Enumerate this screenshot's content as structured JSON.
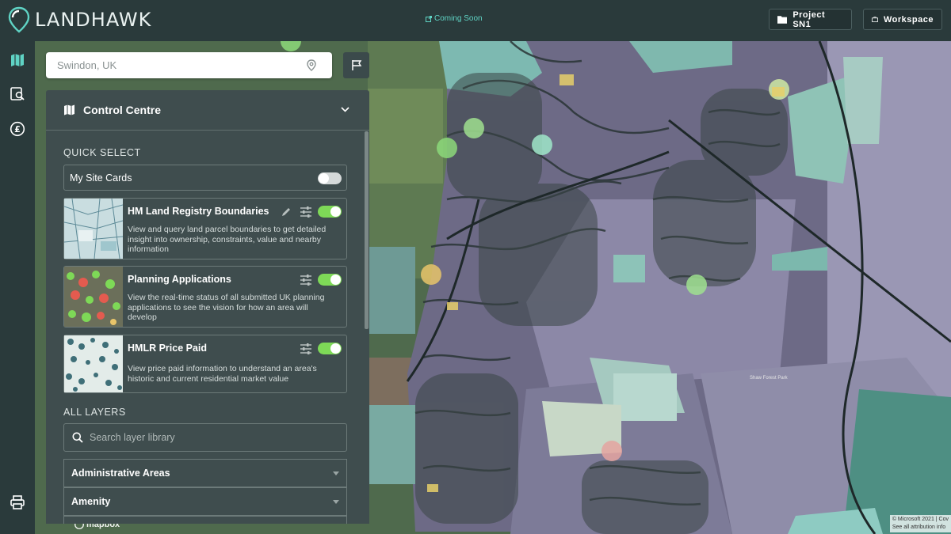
{
  "app": {
    "logo_text": "LANDHAWK",
    "coming_soon": "Coming Soon"
  },
  "header": {
    "project_label": "Project SN1",
    "workspace_label": "Workspace"
  },
  "search": {
    "value": "Swindon, UK"
  },
  "panel": {
    "title": "Control Centre",
    "quick_select_label": "QUICK SELECT",
    "my_site_cards": {
      "label": "My Site Cards",
      "enabled": false
    },
    "layers": [
      {
        "title": "HM Land Registry Boundaries",
        "desc_lines": [
          "View and query land parcel boundaries to get detailed",
          "insight into ownership, constraints, value and nearby",
          "information"
        ],
        "enabled": true,
        "editable": true
      },
      {
        "title": "Planning Applications",
        "desc_lines": [
          "View the real-time status of all submitted UK planning",
          "applications to see the vision for how an area will",
          "develop"
        ],
        "enabled": true,
        "editable": false
      },
      {
        "title": "HMLR Price Paid",
        "desc_lines": [
          "View price paid information to understand an area's",
          "historic and current residential market value"
        ],
        "enabled": true,
        "editable": false
      }
    ],
    "all_layers_label": "ALL LAYERS",
    "layer_search_placeholder": "Search layer library",
    "categories": [
      "Administrative Areas",
      "Amenity"
    ]
  },
  "map": {
    "place_label": "Shaw Forest Park",
    "mapbox_label": "mapbox",
    "attribution_lines": [
      "© Microsoft 2021 | Cov",
      "See all attribution info"
    ]
  },
  "colors": {
    "toggle_on": "#7ed957",
    "toggle_off": "#d5d9d9",
    "accent": "#5fd3c4"
  },
  "icons": [
    "pin-logo-icon",
    "external-link-icon",
    "folder-icon",
    "briefcase-icon",
    "map-icon",
    "site-search-icon",
    "pound-icon",
    "printer-icon",
    "location-pin-icon",
    "flag-icon",
    "map-fold-icon",
    "chevron-down-icon",
    "pencil-icon",
    "sliders-icon",
    "search-icon"
  ]
}
